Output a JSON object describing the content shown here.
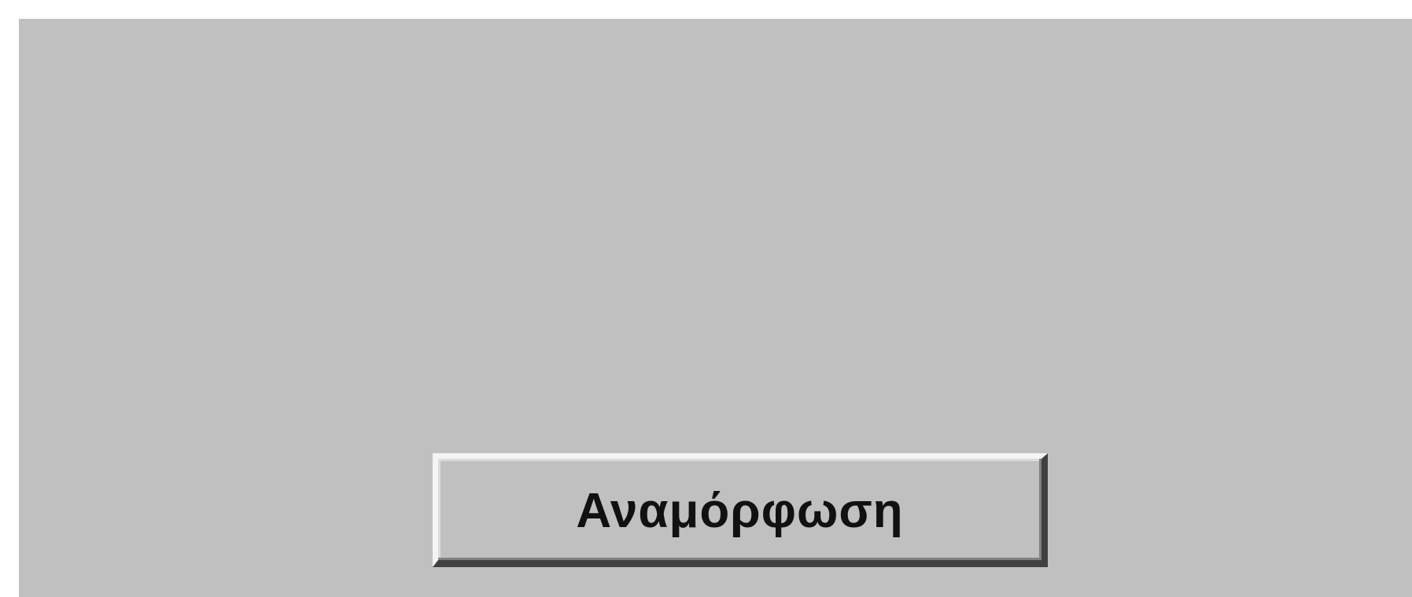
{
  "window": {
    "background_color": "#c0c0c0"
  },
  "actions": {
    "refresh_label": "Αναμόρφωση"
  }
}
